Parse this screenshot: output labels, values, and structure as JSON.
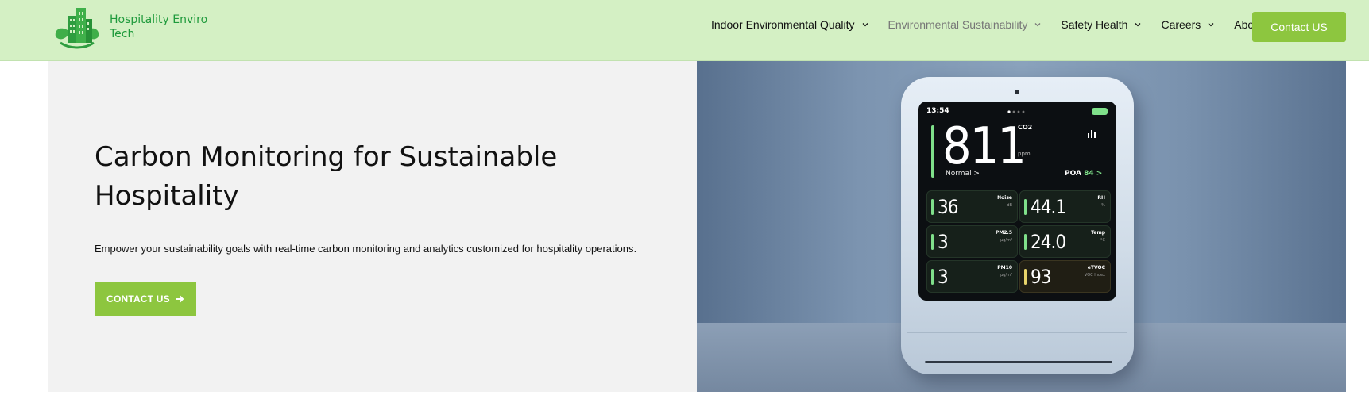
{
  "brand": {
    "name_line1": "Hospitality Enviro",
    "name_line2": "Tech",
    "primary_color": "#8dc63f",
    "header_bg": "#d4f0c4",
    "logo_green": "#1f9a3c"
  },
  "nav": {
    "items": [
      {
        "label": "Indoor Environmental Quality",
        "has_dropdown": true
      },
      {
        "label": "Environmental Sustainability",
        "has_dropdown": true,
        "active": true
      },
      {
        "label": "Safety Health",
        "has_dropdown": true
      },
      {
        "label": "Careers",
        "has_dropdown": true
      },
      {
        "label": "About Us",
        "has_dropdown": false
      }
    ],
    "contact_label": "Contact US"
  },
  "hero": {
    "title": "Carbon Monitoring for Sustainable Hospitality",
    "description": "Empower your sustainability goals with real-time carbon monitoring and analytics customized for hospitality operations.",
    "cta_label": "CONTACT US",
    "cta_icon": "arrow-right-icon"
  },
  "device": {
    "time": "13:54",
    "main_value": "811",
    "main_label": "CO2",
    "main_unit": "ppm",
    "status": "Normal >",
    "poa_label": "POA",
    "poa_value": "84 >",
    "tiles": [
      {
        "value": "36",
        "label": "Noise",
        "unit": "dB",
        "color": "green"
      },
      {
        "value": "44.1",
        "label": "RH",
        "unit": "%",
        "color": "green"
      },
      {
        "value": "3",
        "label": "PM2.5",
        "unit": "µg/m³",
        "color": "green"
      },
      {
        "value": "24.0",
        "label": "Temp",
        "unit": "°C",
        "color": "green"
      },
      {
        "value": "3",
        "label": "PM10",
        "unit": "µg/m³",
        "color": "green"
      },
      {
        "value": "93",
        "label": "eTVOC",
        "unit": "VOC Index",
        "color": "yellow"
      }
    ]
  }
}
